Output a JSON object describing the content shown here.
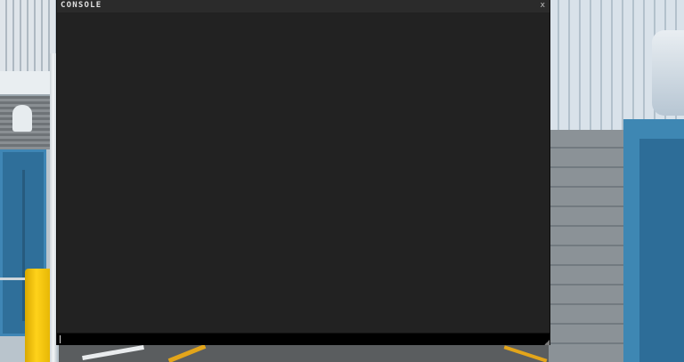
{
  "console": {
    "title": "CONSOLE",
    "close_label": "x",
    "log_lines": [],
    "input_value": ""
  },
  "icons": {
    "close": "close-icon",
    "resize": "resize-grip-icon"
  },
  "colors": {
    "console_bg": "#222222",
    "titlebar_bg": "#2b2b2b",
    "input_bg": "#000000",
    "bollard_yellow": "#ffd21a",
    "door_blue": "#2f6f9a"
  }
}
